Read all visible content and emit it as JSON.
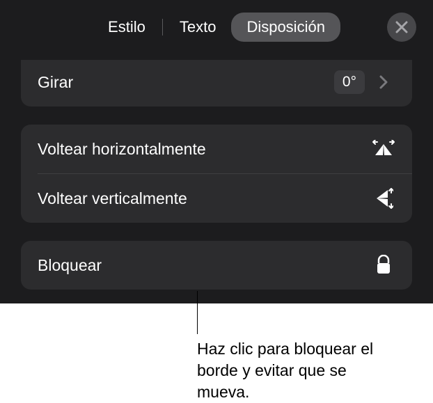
{
  "tabs": {
    "style": "Estilo",
    "text": "Texto",
    "layout": "Disposición"
  },
  "rotate": {
    "label": "Girar",
    "value": "0°"
  },
  "flip": {
    "horizontal": "Voltear horizontalmente",
    "vertical": "Voltear verticalmente"
  },
  "lock": {
    "label": "Bloquear"
  },
  "callout": "Haz clic para bloquear el borde y evitar que se mueva."
}
